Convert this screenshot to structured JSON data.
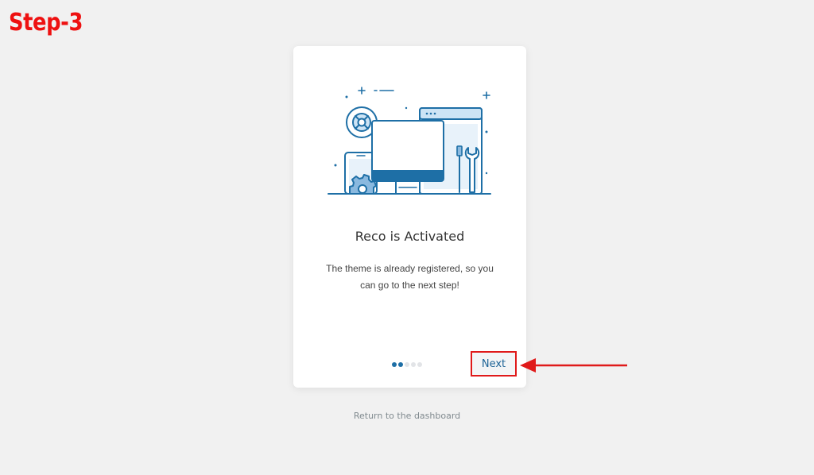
{
  "annotation": {
    "step_label": "Step-3"
  },
  "card": {
    "title": "Reco is Activated",
    "message": "The theme is already registered, so you can go to the next step!",
    "pagination": {
      "total": 5,
      "active": [
        0,
        1
      ]
    },
    "next_label": "Next"
  },
  "footer": {
    "return_link": "Return to the dashboard"
  },
  "colors": {
    "accent": "#1e6fa6",
    "annotation_red": "#e01a1a",
    "background": "#f1f1f1"
  }
}
